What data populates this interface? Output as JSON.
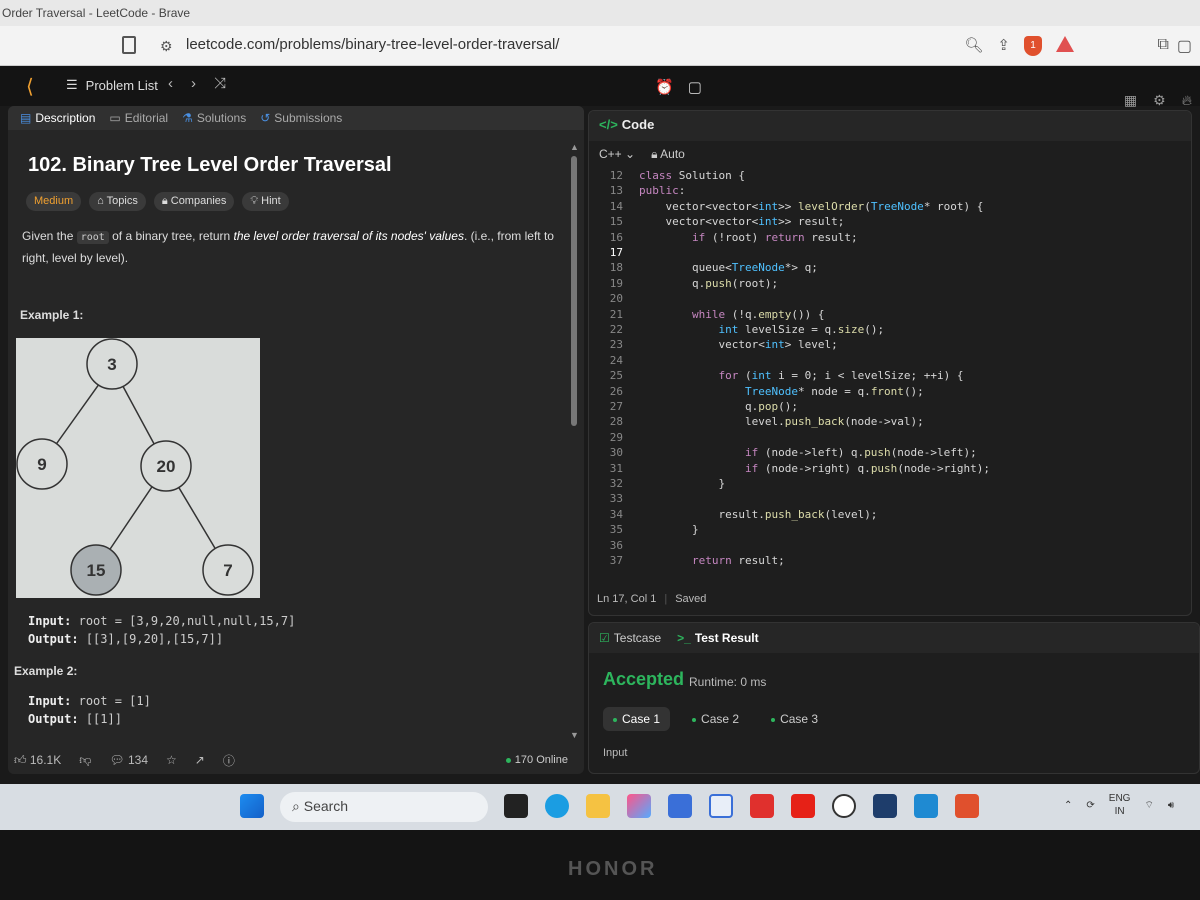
{
  "window_title": "Order Traversal - LeetCode - Brave",
  "address": {
    "url": "leetcode.com/problems/binary-tree-level-order-traversal/",
    "shield_count": "1"
  },
  "lcnav": {
    "problem_list": "Problem List"
  },
  "tabs": [
    "Description",
    "Editorial",
    "Solutions",
    "Submissions"
  ],
  "problem": {
    "title": "102. Binary Tree Level Order Traversal",
    "difficulty": "Medium",
    "tags": [
      "Topics",
      "Companies",
      "Hint"
    ],
    "desc_1": "Given the ",
    "desc_code": "root",
    "desc_2": " of a binary tree, return ",
    "desc_italic": "the level order traversal of its nodes' values",
    "desc_3": ". (i.e., from left to right, level by level).",
    "example1_label": "Example 1:",
    "tree_nodes": [
      "3",
      "9",
      "20",
      "15",
      "7"
    ],
    "ex1_input_label": "Input:",
    "ex1_input": "root = [3,9,20,null,null,15,7]",
    "ex1_output_label": "Output:",
    "ex1_output": "[[3],[9,20],[15,7]]",
    "example2_label": "Example 2:",
    "ex2_input_label": "Input:",
    "ex2_input": "root = [1]",
    "ex2_output_label": "Output:",
    "ex2_output": "[[1]]"
  },
  "footer": {
    "likes": "16.1K",
    "comments": "134",
    "online": "170 Online"
  },
  "code": {
    "header": "Code",
    "language": "C++",
    "mode": "Auto",
    "lines": [
      {
        "n": "12",
        "t": "class Solution {"
      },
      {
        "n": "13",
        "t": "public:"
      },
      {
        "n": "14",
        "t": "    vector<vector<int>> levelOrder(TreeNode* root) {"
      },
      {
        "n": "15",
        "t": "    vector<vector<int>> result;"
      },
      {
        "n": "16",
        "t": "        if (!root) return result;"
      },
      {
        "n": "17",
        "t": ""
      },
      {
        "n": "18",
        "t": "        queue<TreeNode*> q;"
      },
      {
        "n": "19",
        "t": "        q.push(root);"
      },
      {
        "n": "20",
        "t": ""
      },
      {
        "n": "21",
        "t": "        while (!q.empty()) {"
      },
      {
        "n": "22",
        "t": "            int levelSize = q.size();"
      },
      {
        "n": "23",
        "t": "            vector<int> level;"
      },
      {
        "n": "24",
        "t": ""
      },
      {
        "n": "25",
        "t": "            for (int i = 0; i < levelSize; ++i) {"
      },
      {
        "n": "26",
        "t": "                TreeNode* node = q.front();"
      },
      {
        "n": "27",
        "t": "                q.pop();"
      },
      {
        "n": "28",
        "t": "                level.push_back(node->val);"
      },
      {
        "n": "29",
        "t": ""
      },
      {
        "n": "30",
        "t": "                if (node->left) q.push(node->left);"
      },
      {
        "n": "31",
        "t": "                if (node->right) q.push(node->right);"
      },
      {
        "n": "32",
        "t": "            }"
      },
      {
        "n": "33",
        "t": ""
      },
      {
        "n": "34",
        "t": "            result.push_back(level);"
      },
      {
        "n": "35",
        "t": "        }"
      },
      {
        "n": "36",
        "t": ""
      },
      {
        "n": "37",
        "t": "        return result;"
      }
    ],
    "cursor_line": "17",
    "status_pos": "Ln 17, Col 1",
    "status_saved": "Saved"
  },
  "test": {
    "tab_testcase": "Testcase",
    "tab_result": "Test Result",
    "status": "Accepted",
    "runtime": "Runtime: 0 ms",
    "cases": [
      "Case 1",
      "Case 2",
      "Case 3"
    ],
    "input_label": "Input"
  },
  "taskbar": {
    "search": "Search",
    "lang_1": "ENG",
    "lang_2": "IN"
  },
  "brand": "HONOR",
  "colors": {
    "accent_green": "#2db55d",
    "medium": "#f0a030",
    "link_blue": "#4a90e2"
  }
}
